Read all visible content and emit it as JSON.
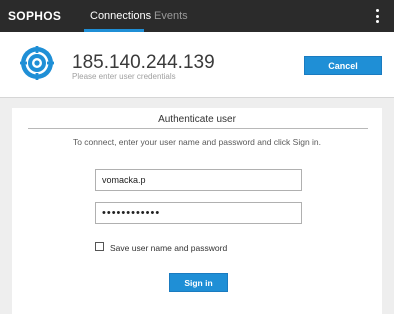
{
  "topbar": {
    "brand": "SOPHOS",
    "tabs": [
      {
        "label": "Connections",
        "active": true
      },
      {
        "label": "Events",
        "active": false
      }
    ],
    "menu_icon": "kebab-menu-icon"
  },
  "header": {
    "logo_icon": "sophos-target-icon",
    "server_address": "185.140.244.139",
    "subtitle": "Please enter user credentials",
    "cancel_label": "Cancel"
  },
  "auth": {
    "title": "Authenticate user",
    "instructions": "To connect, enter your user name and password and click Sign in.",
    "username_value": "vomacka.p",
    "password_value": "••••••••••••",
    "save_checkbox_checked": false,
    "save_label": "Save user name and password",
    "signin_label": "Sign in"
  },
  "colors": {
    "topbar": "#2b2b2b",
    "accent": "#1f8fd6",
    "content_bg": "#eeeeee"
  }
}
